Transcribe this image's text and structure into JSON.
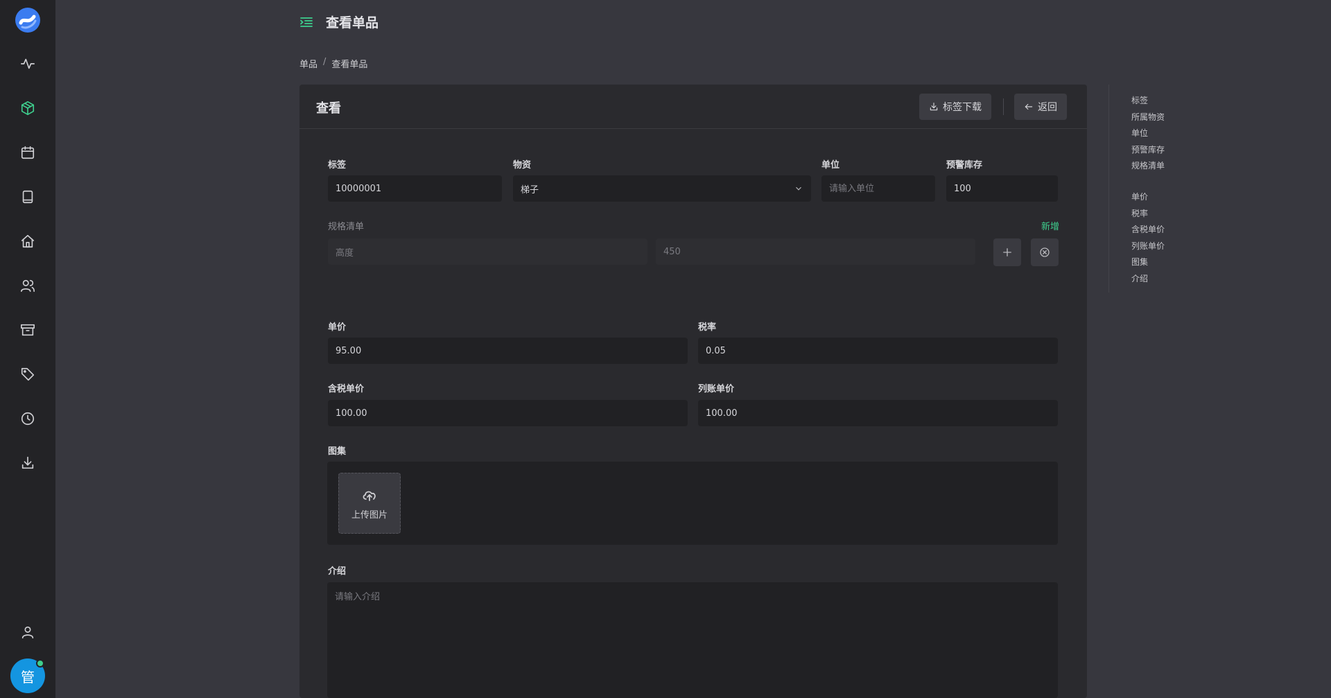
{
  "sidebar": {
    "items": [
      {
        "icon": "activity-icon"
      },
      {
        "icon": "cube-icon",
        "active": true
      },
      {
        "icon": "calendar-icon"
      },
      {
        "icon": "book-icon"
      },
      {
        "icon": "home-icon"
      },
      {
        "icon": "users-icon"
      },
      {
        "icon": "archive-icon"
      },
      {
        "icon": "tag-icon"
      },
      {
        "icon": "clock-icon"
      },
      {
        "icon": "download-icon"
      }
    ],
    "user_icon": "user-icon",
    "avatar_text": "管"
  },
  "header": {
    "title": "查看单品"
  },
  "breadcrumb": {
    "items": [
      "单品",
      "查看单品"
    ],
    "separator": "/"
  },
  "card": {
    "title": "查看",
    "download_label": "标签下载",
    "back_label": "返回"
  },
  "form": {
    "tag_label": "标签",
    "tag_value": "10000001",
    "material_label": "物资",
    "material_value": "梯子",
    "unit_label": "单位",
    "unit_placeholder": "请输入单位",
    "stock_label": "预警库存",
    "stock_value": "100",
    "spec_label": "规格清单",
    "spec_add": "新增",
    "spec_name_value": "高度",
    "spec_value_value": "450",
    "price_label": "单价",
    "price_value": "95.00",
    "tax_label": "税率",
    "tax_value": "0.05",
    "tax_price_label": "含税单价",
    "tax_price_value": "100.00",
    "list_price_label": "列账单价",
    "list_price_value": "100.00",
    "gallery_label": "图集",
    "upload_label": "上传图片",
    "intro_label": "介绍",
    "intro_placeholder": "请输入介绍"
  },
  "anchor_nav": {
    "group1": [
      "标签",
      "所属物资",
      "单位",
      "预警库存",
      "规格清单"
    ],
    "group2": [
      "单价",
      "税率",
      "含税单价",
      "列账单价",
      "图集",
      "介绍"
    ]
  },
  "colors": {
    "accent": "#3ecf8e",
    "avatar": "#1495e0",
    "background": "#37373e",
    "sidebar": "#232326"
  }
}
